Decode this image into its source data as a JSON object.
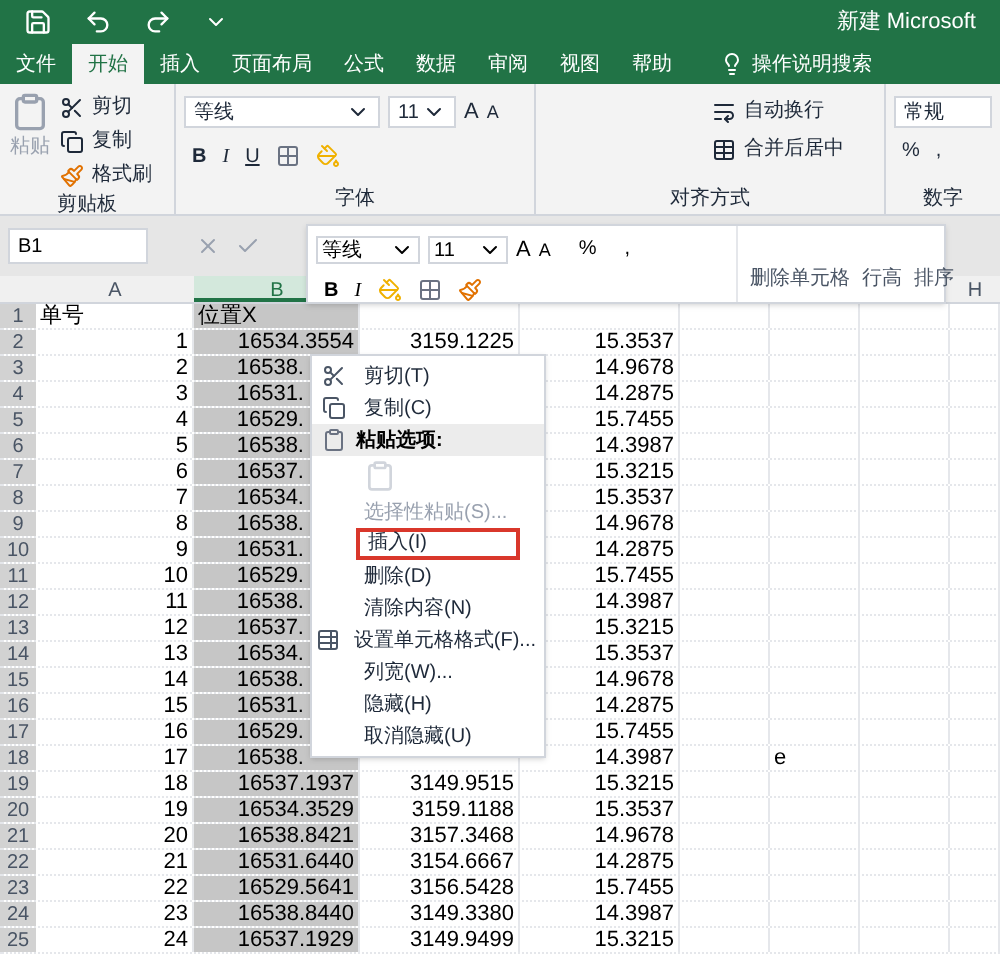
{
  "title_bar": {
    "title": "新建 Microsoft"
  },
  "tabs": [
    {
      "label": "文件",
      "selected": false
    },
    {
      "label": "开始",
      "selected": true
    },
    {
      "label": "插入",
      "selected": false
    },
    {
      "label": "页面布局",
      "selected": false
    },
    {
      "label": "公式",
      "selected": false
    },
    {
      "label": "数据",
      "selected": false
    },
    {
      "label": "审阅",
      "selected": false
    },
    {
      "label": "视图",
      "selected": false
    },
    {
      "label": "帮助",
      "selected": false
    }
  ],
  "tell_me": {
    "placeholder": "操作说明搜索"
  },
  "ribbon": {
    "clipboard": {
      "paste": "粘贴",
      "cut": "剪切",
      "copy": "复制",
      "format_painter": "格式刷",
      "label": "剪贴板"
    },
    "font": {
      "name": "等线",
      "size": "11",
      "grow": "A",
      "shrink": "A",
      "bold": "B",
      "italic": "I",
      "underline": "U",
      "label": "字体"
    },
    "alignment": {
      "wrap": "自动换行",
      "merge": "合并后居中",
      "label": "对齐方式"
    },
    "number": {
      "format": "常规",
      "percent": "%",
      "comma": ",",
      "label": "数字"
    }
  },
  "formula_bar": {
    "name_box": "B1"
  },
  "column_headers": {
    "A": {
      "label": "A",
      "selected": false
    },
    "B": {
      "label": "B",
      "selected": true
    },
    "H": {
      "label": "H",
      "selected": false
    }
  },
  "rows": [
    {
      "number": "1",
      "cells": {
        "A": "单号",
        "B": "位置X"
      }
    },
    {
      "number": "2",
      "cells": {
        "A": "1",
        "B": "16534.3554",
        "C": "3159.1225",
        "D": "15.3537"
      }
    },
    {
      "number": "3",
      "clipped": true,
      "cells": {
        "A": "2",
        "B": "16538.",
        "D": "14.9678"
      }
    },
    {
      "number": "4",
      "clipped": true,
      "cells": {
        "A": "3",
        "B": "16531.",
        "D": "14.2875"
      }
    },
    {
      "number": "5",
      "clipped": true,
      "cells": {
        "A": "4",
        "B": "16529.",
        "D": "15.7455"
      }
    },
    {
      "number": "6",
      "clipped": true,
      "cells": {
        "A": "5",
        "B": "16538.",
        "D": "14.3987"
      }
    },
    {
      "number": "7",
      "clipped": true,
      "cells": {
        "A": "6",
        "B": "16537.",
        "D": "15.3215"
      }
    },
    {
      "number": "8",
      "clipped": true,
      "cells": {
        "A": "7",
        "B": "16534.",
        "D": "15.3537"
      }
    },
    {
      "number": "9",
      "clipped": true,
      "cells": {
        "A": "8",
        "B": "16538.",
        "D": "14.9678"
      }
    },
    {
      "number": "10",
      "clipped": true,
      "cells": {
        "A": "9",
        "B": "16531.",
        "D": "14.2875"
      }
    },
    {
      "number": "11",
      "clipped": true,
      "cells": {
        "A": "10",
        "B": "16529.",
        "D": "15.7455"
      }
    },
    {
      "number": "12",
      "clipped": true,
      "cells": {
        "A": "11",
        "B": "16538.",
        "D": "14.3987"
      }
    },
    {
      "number": "13",
      "clipped": true,
      "cells": {
        "A": "12",
        "B": "16537.",
        "D": "15.3215"
      }
    },
    {
      "number": "14",
      "clipped": true,
      "cells": {
        "A": "13",
        "B": "16534.",
        "D": "15.3537"
      }
    },
    {
      "number": "15",
      "clipped": true,
      "cells": {
        "A": "14",
        "B": "16538.",
        "D": "14.9678"
      }
    },
    {
      "number": "16",
      "clipped": true,
      "cells": {
        "A": "15",
        "B": "16531.",
        "D": "14.2875"
      }
    },
    {
      "number": "17",
      "clipped": true,
      "cells": {
        "A": "16",
        "B": "16529.",
        "D": "15.7455"
      }
    },
    {
      "number": "18",
      "clipped": true,
      "cells": {
        "A": "17",
        "B": "16538.",
        "D": "14.3987",
        "F": "e"
      }
    },
    {
      "number": "19",
      "cells": {
        "A": "18",
        "B": "16537.1937",
        "C": "3149.9515",
        "D": "15.3215"
      }
    },
    {
      "number": "20",
      "cells": {
        "A": "19",
        "B": "16534.3529",
        "C": "3159.1188",
        "D": "15.3537"
      }
    },
    {
      "number": "21",
      "cells": {
        "A": "20",
        "B": "16538.8421",
        "C": "3157.3468",
        "D": "14.9678"
      }
    },
    {
      "number": "22",
      "cells": {
        "A": "21",
        "B": "16531.6440",
        "C": "3154.6667",
        "D": "14.2875"
      }
    },
    {
      "number": "23",
      "cells": {
        "A": "22",
        "B": "16529.5641",
        "C": "3156.5428",
        "D": "15.7455"
      }
    },
    {
      "number": "24",
      "cells": {
        "A": "23",
        "B": "16538.8440",
        "C": "3149.3380",
        "D": "14.3987"
      }
    },
    {
      "number": "25",
      "cells": {
        "A": "24",
        "B": "16537.1929",
        "C": "3149.9499",
        "D": "15.3215"
      }
    }
  ],
  "mini_toolbar": {
    "font": "等线",
    "size": "11",
    "grow": "A",
    "shrink": "A",
    "bold": "B",
    "italic": "I",
    "percent": "%",
    "comma": ",",
    "commands": [
      "删除单元格",
      "行高",
      "排序"
    ]
  },
  "context_menu": [
    {
      "kind": "item",
      "label": "剪切(T)",
      "disabled": false,
      "selected": false
    },
    {
      "kind": "item",
      "label": "复制(C)",
      "disabled": false,
      "selected": false
    },
    {
      "kind": "header",
      "label": "粘贴选项:"
    },
    {
      "kind": "paste-options"
    },
    {
      "kind": "item",
      "label": "选择性粘贴(S)...",
      "disabled": true,
      "selected": false
    },
    {
      "kind": "item",
      "label": "插入(I)",
      "disabled": false,
      "selected": true
    },
    {
      "kind": "item",
      "label": "删除(D)",
      "disabled": false,
      "selected": false
    },
    {
      "kind": "item",
      "label": "清除内容(N)",
      "disabled": false,
      "selected": false
    },
    {
      "kind": "item",
      "label": "设置单元格格式(F)...",
      "disabled": false,
      "selected": false
    },
    {
      "kind": "item",
      "label": "列宽(W)...",
      "disabled": false,
      "selected": false
    },
    {
      "kind": "item",
      "label": "隐藏(H)",
      "disabled": false,
      "selected": false
    },
    {
      "kind": "item",
      "label": "取消隐藏(U)",
      "disabled": false,
      "selected": false
    }
  ]
}
